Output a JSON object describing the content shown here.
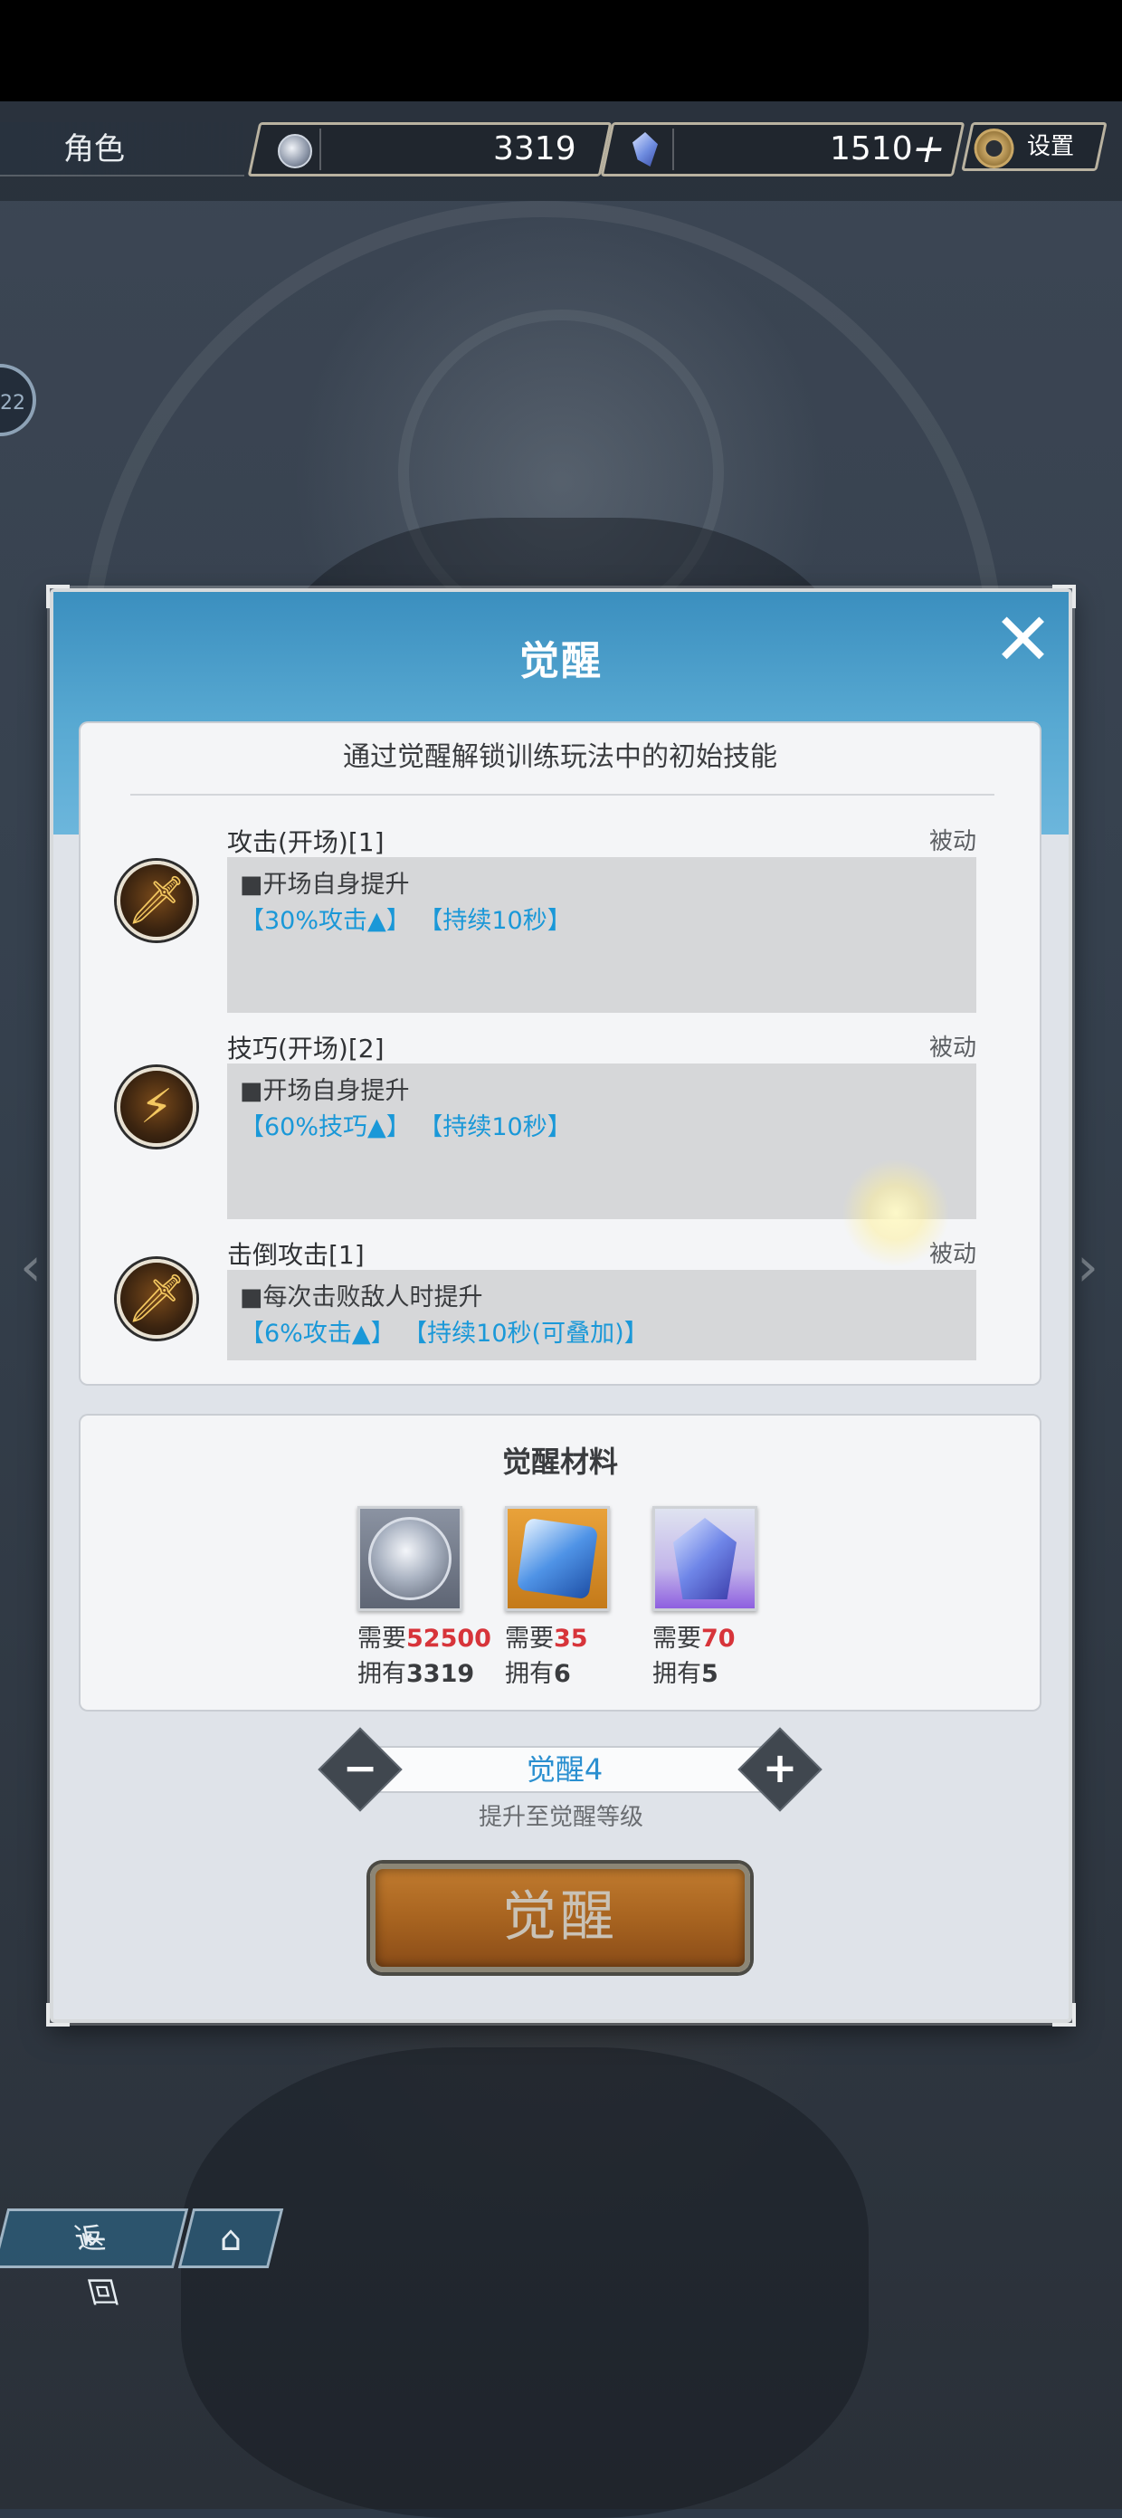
{
  "topbar": {
    "role_label": "角色",
    "silver_amount": "3319",
    "crystal_amount": "1510",
    "add_symbol": "+",
    "settings_label": "设置",
    "level_badge": "22"
  },
  "modal": {
    "title": "觉醒",
    "close_symbol": "✕",
    "intro": "通过觉醒解锁训练玩法中的初始技能",
    "skills": [
      {
        "name": "攻击(开场)[1]",
        "type": "被动",
        "desc": "■开场自身提升",
        "effect": "【30%攻击▲】 【持续10秒】",
        "icon": "sword-icon"
      },
      {
        "name": "技巧(开场)[2]",
        "type": "被动",
        "desc": "■开场自身提升",
        "effect": "【60%技巧▲】 【持续10秒】",
        "icon": "lightning-icon"
      },
      {
        "name": "击倒攻击[1]",
        "type": "被动",
        "desc": "■每次击败敌人时提升",
        "effect": "【6%攻击▲】 【持续10秒(可叠加)】",
        "icon": "sword-icon"
      }
    ],
    "materials": {
      "title": "觉醒材料",
      "need_prefix": "需要",
      "have_prefix": "拥有",
      "items": [
        {
          "icon": "silver-coin-icon",
          "need": "52500",
          "have": "3319"
        },
        {
          "icon": "blue-gem-icon",
          "need": "35",
          "have": "6"
        },
        {
          "icon": "purple-crystal-icon",
          "need": "70",
          "have": "5"
        }
      ]
    },
    "stepper": {
      "value": "觉醒4",
      "minus": "−",
      "plus": "+",
      "subtitle": "提升至觉醒等级"
    },
    "action_button": "觉醒"
  },
  "bottom_nav": {
    "back_label": "返回",
    "home_icon": "home-icon"
  },
  "colors": {
    "header_blue": "#58a9d2",
    "effect_blue": "#1a98d8",
    "need_red": "#d7343a",
    "button_orange": "#a86420"
  }
}
